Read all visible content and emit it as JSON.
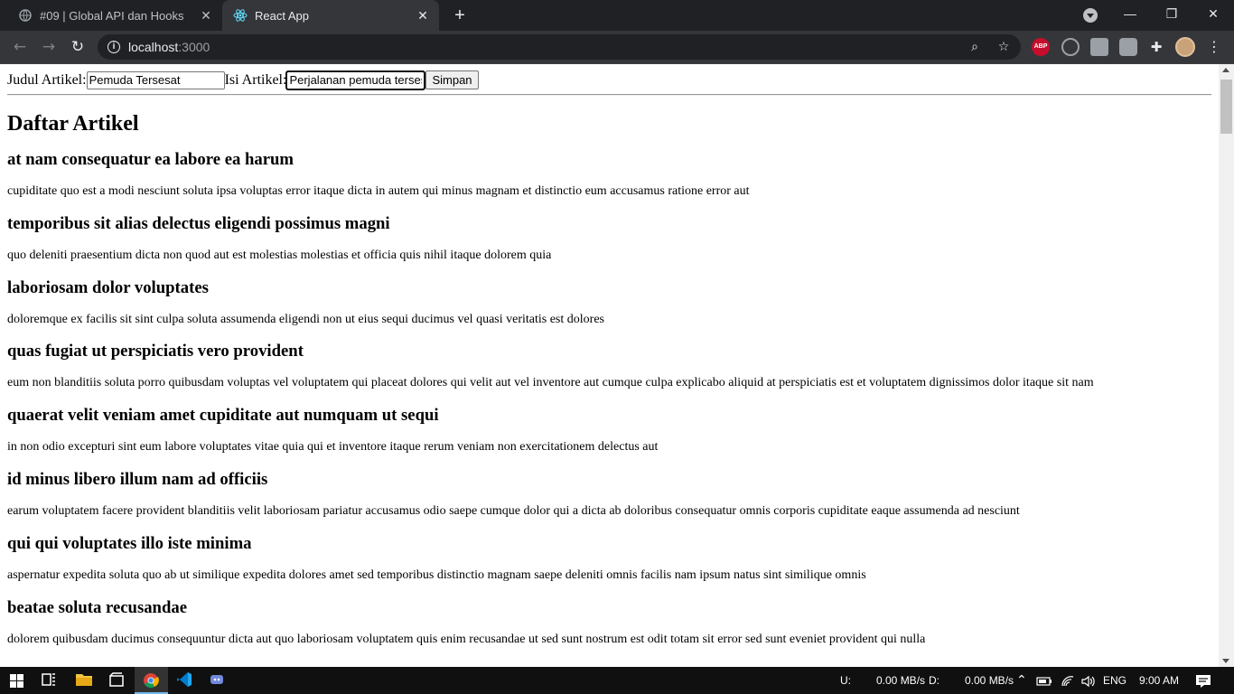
{
  "browser": {
    "tabs": [
      {
        "title": "#09 | Global API dan Hooks",
        "active": false
      },
      {
        "title": "React App",
        "active": true
      }
    ],
    "url_host": "localhost",
    "url_port": ":3000"
  },
  "form": {
    "judul_label": "Judul Artikel:",
    "judul_value": "Pemuda Tersesat",
    "isi_label": "Isi Artikel:",
    "isi_value": "Perjalanan pemuda tersesat",
    "submit_label": "Simpan"
  },
  "heading": "Daftar Artikel",
  "articles": [
    {
      "title": "at nam consequatur ea labore ea harum",
      "body": "cupiditate quo est a modi nesciunt soluta ipsa voluptas error itaque dicta in autem qui minus magnam et distinctio eum accusamus ratione error aut"
    },
    {
      "title": "temporibus sit alias delectus eligendi possimus magni",
      "body": "quo deleniti praesentium dicta non quod aut est molestias molestias et officia quis nihil itaque dolorem quia"
    },
    {
      "title": "laboriosam dolor voluptates",
      "body": "doloremque ex facilis sit sint culpa soluta assumenda eligendi non ut eius sequi ducimus vel quasi veritatis est dolores"
    },
    {
      "title": "quas fugiat ut perspiciatis vero provident",
      "body": "eum non blanditiis soluta porro quibusdam voluptas vel voluptatem qui placeat dolores qui velit aut vel inventore aut cumque culpa explicabo aliquid at perspiciatis est et voluptatem dignissimos dolor itaque sit nam"
    },
    {
      "title": "quaerat velit veniam amet cupiditate aut numquam ut sequi",
      "body": "in non odio excepturi sint eum labore voluptates vitae quia qui et inventore itaque rerum veniam non exercitationem delectus aut"
    },
    {
      "title": "id minus libero illum nam ad officiis",
      "body": "earum voluptatem facere provident blanditiis velit laboriosam pariatur accusamus odio saepe cumque dolor qui a dicta ab doloribus consequatur omnis corporis cupiditate eaque assumenda ad nesciunt"
    },
    {
      "title": "qui qui voluptates illo iste minima",
      "body": "aspernatur expedita soluta quo ab ut similique expedita dolores amet sed temporibus distinctio magnam saepe deleniti omnis facilis nam ipsum natus sint similique omnis"
    },
    {
      "title": "beatae soluta recusandae",
      "body": "dolorem quibusdam ducimus consequuntur dicta aut quo laboriosam voluptatem quis enim recusandae ut sed sunt nostrum est odit totam sit error sed sunt eveniet provident qui nulla"
    }
  ],
  "taskbar": {
    "net_up_label": "U:",
    "net_up_value": "0.00 MB/s",
    "net_down_label": "D:",
    "net_down_value": "0.00 MB/s",
    "language": "ENG",
    "time": "9:00 AM"
  }
}
